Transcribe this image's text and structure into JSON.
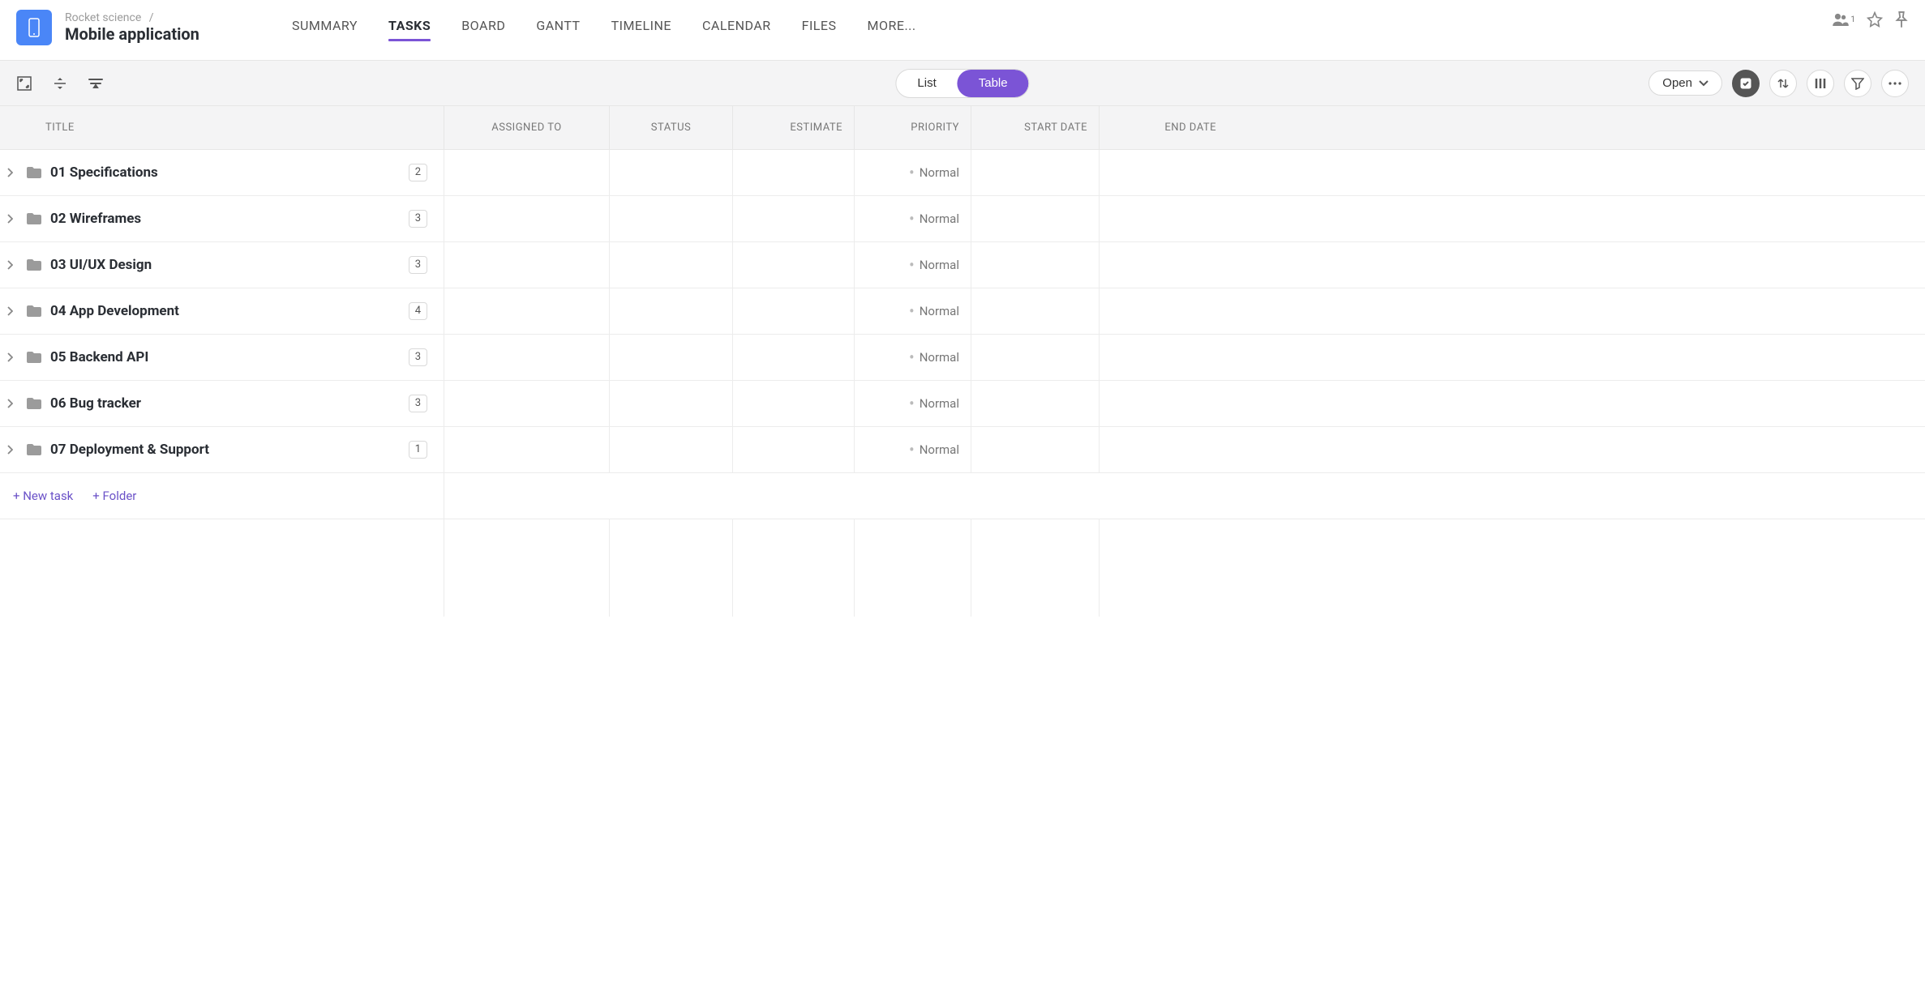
{
  "header": {
    "breadcrumb_parent": "Rocket science",
    "breadcrumb_separator": "/",
    "project_title": "Mobile application",
    "tabs": [
      "SUMMARY",
      "TASKS",
      "BOARD",
      "GANTT",
      "TIMELINE",
      "CALENDAR",
      "FILES",
      "MORE..."
    ],
    "active_tab_index": 1,
    "share_count": "1"
  },
  "toolbar": {
    "view_list": "List",
    "view_table": "Table",
    "active_view": "Table",
    "open_label": "Open"
  },
  "columns": {
    "title": "TITLE",
    "assigned_to": "ASSIGNED TO",
    "status": "STATUS",
    "estimate": "ESTIMATE",
    "priority": "PRIORITY",
    "start_date": "START DATE",
    "end_date": "END DATE"
  },
  "rows": [
    {
      "title": "01 Specifications",
      "count": "2",
      "priority": "Normal"
    },
    {
      "title": "02 Wireframes",
      "count": "3",
      "priority": "Normal"
    },
    {
      "title": "03 UI/UX Design",
      "count": "3",
      "priority": "Normal"
    },
    {
      "title": "04 App Development",
      "count": "4",
      "priority": "Normal"
    },
    {
      "title": "05 Backend API",
      "count": "3",
      "priority": "Normal"
    },
    {
      "title": "06 Bug tracker",
      "count": "3",
      "priority": "Normal"
    },
    {
      "title": "07 Deployment & Support",
      "count": "1",
      "priority": "Normal"
    }
  ],
  "footer": {
    "new_task": "+ New task",
    "new_folder": "+ Folder"
  }
}
